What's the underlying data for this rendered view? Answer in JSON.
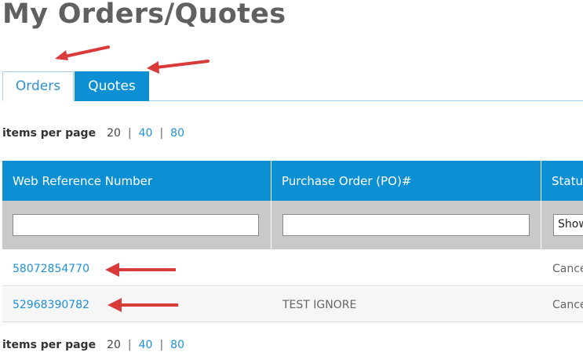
{
  "page": {
    "title": "My Orders/Quotes"
  },
  "tabs": [
    {
      "label": "Orders",
      "active": true
    },
    {
      "label": "Quotes",
      "active": false
    }
  ],
  "pager": {
    "label": "items per page",
    "current": "20",
    "separator": "|",
    "links": [
      "40",
      "80"
    ]
  },
  "table": {
    "columns": [
      "Web Reference Number",
      "Purchase Order (PO)#",
      "Status"
    ],
    "filters": {
      "web_reference": "",
      "purchase_order": "",
      "status_select": "Show"
    },
    "rows": [
      {
        "web_reference": "58072854770",
        "purchase_order": "",
        "status": "Cancelled"
      },
      {
        "web_reference": "52968390782",
        "purchase_order": "TEST IGNORE",
        "status": "Cancelled"
      }
    ]
  },
  "annotations": {
    "arrow_color": "#d93a3a"
  },
  "colors": {
    "accent": "#0c8fd3",
    "link": "#1e90d6",
    "title": "#606060",
    "filter_bg": "#c9c9c9"
  }
}
